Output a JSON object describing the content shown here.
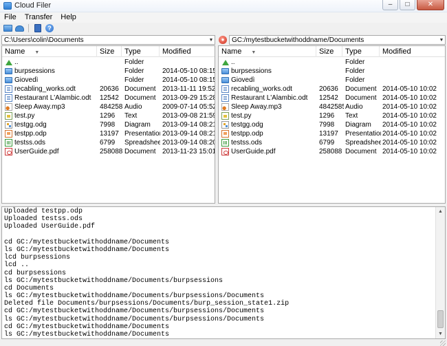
{
  "window": {
    "title": "Cloud Filer"
  },
  "menu": [
    "File",
    "Transfer",
    "Help"
  ],
  "toolbar": {
    "help_glyph": "?"
  },
  "left": {
    "path": "C:\\Users\\colin\\Documents",
    "columns": [
      "Name",
      "Size",
      "Type",
      "Modified"
    ],
    "rows": [
      {
        "icon": "up",
        "name": "..",
        "size": "",
        "type": "Folder",
        "modified": ""
      },
      {
        "icon": "folder",
        "name": "burpsessions",
        "size": "",
        "type": "Folder",
        "modified": "2014-05-10 08:15"
      },
      {
        "icon": "folder",
        "name": "Giovedì",
        "size": "",
        "type": "Folder",
        "modified": "2014-05-10 08:15"
      },
      {
        "icon": "doc",
        "name": "recabling_works.odt",
        "size": "20636",
        "type": "Document",
        "modified": "2013-11-11 19:52"
      },
      {
        "icon": "doc",
        "name": "Restaurant L'Alambic.odt",
        "size": "12542",
        "type": "Document",
        "modified": "2013-09-29 15:28"
      },
      {
        "icon": "audio",
        "name": "Sleep Away.mp3",
        "size": "4842585",
        "type": "Audio",
        "modified": "2009-07-14 05:52"
      },
      {
        "icon": "text",
        "name": "test.py",
        "size": "1296",
        "type": "Text",
        "modified": "2013-09-08 21:59"
      },
      {
        "icon": "diagram",
        "name": "testgg.odg",
        "size": "7998",
        "type": "Diagram",
        "modified": "2013-09-14 08:21"
      },
      {
        "icon": "pres",
        "name": "testpp.odp",
        "size": "13197",
        "type": "Presentation",
        "modified": "2013-09-14 08:21"
      },
      {
        "icon": "sheet",
        "name": "testss.ods",
        "size": "6799",
        "type": "Spreadsheet",
        "modified": "2013-09-14 08:20"
      },
      {
        "icon": "pdf",
        "name": "UserGuide.pdf",
        "size": "258088",
        "type": "Document",
        "modified": "2013-11-23 15:01"
      }
    ]
  },
  "right": {
    "path": "GC:/mytestbucketwithoddname/Documents",
    "columns": [
      "Name",
      "Size",
      "Type",
      "Modified"
    ],
    "rows": [
      {
        "icon": "up",
        "name": "..",
        "size": "",
        "type": "Folder",
        "modified": ""
      },
      {
        "icon": "folder",
        "name": "burpsessions",
        "size": "",
        "type": "Folder",
        "modified": ""
      },
      {
        "icon": "folder",
        "name": "Giovedì",
        "size": "",
        "type": "Folder",
        "modified": ""
      },
      {
        "icon": "doc",
        "name": "recabling_works.odt",
        "size": "20636",
        "type": "Document",
        "modified": "2014-05-10 10:02"
      },
      {
        "icon": "doc",
        "name": "Restaurant L'Alambic.odt",
        "size": "12542",
        "type": "Document",
        "modified": "2014-05-10 10:02"
      },
      {
        "icon": "audio",
        "name": "Sleep Away.mp3",
        "size": "4842585",
        "type": "Audio",
        "modified": "2014-05-10 10:02"
      },
      {
        "icon": "text",
        "name": "test.py",
        "size": "1296",
        "type": "Text",
        "modified": "2014-05-10 10:02"
      },
      {
        "icon": "diagram",
        "name": "testgg.odg",
        "size": "7998",
        "type": "Diagram",
        "modified": "2014-05-10 10:02"
      },
      {
        "icon": "pres",
        "name": "testpp.odp",
        "size": "13197",
        "type": "Presentation",
        "modified": "2014-05-10 10:02"
      },
      {
        "icon": "sheet",
        "name": "testss.ods",
        "size": "6799",
        "type": "Spreadsheet",
        "modified": "2014-05-10 10:02"
      },
      {
        "icon": "pdf",
        "name": "UserGuide.pdf",
        "size": "258088",
        "type": "Document",
        "modified": "2014-05-10 10:02"
      }
    ]
  },
  "log": [
    "Uploaded testpp.odp",
    "Uploaded testss.ods",
    "Uploaded UserGuide.pdf",
    "",
    "cd GC:/mytestbucketwithoddname/Documents",
    "ls GC:/mytestbucketwithoddname/Documents",
    "lcd burpsessions",
    "lcd ..",
    "cd burpsessions",
    "ls GC:/mytestbucketwithoddname/Documents/burpsessions",
    "cd Documents",
    "ls GC:/mytestbucketwithoddname/Documents/burpsessions/Documents",
    "Deleted file Documents/burpsessions/Documents/burp_session_state1.zip",
    "cd GC:/mytestbucketwithoddname/Documents/burpsessions/Documents",
    "ls GC:/mytestbucketwithoddname/Documents/burpsessions/Documents",
    "cd GC:/mytestbucketwithoddname/Documents",
    "ls GC:/mytestbucketwithoddname/Documents"
  ]
}
